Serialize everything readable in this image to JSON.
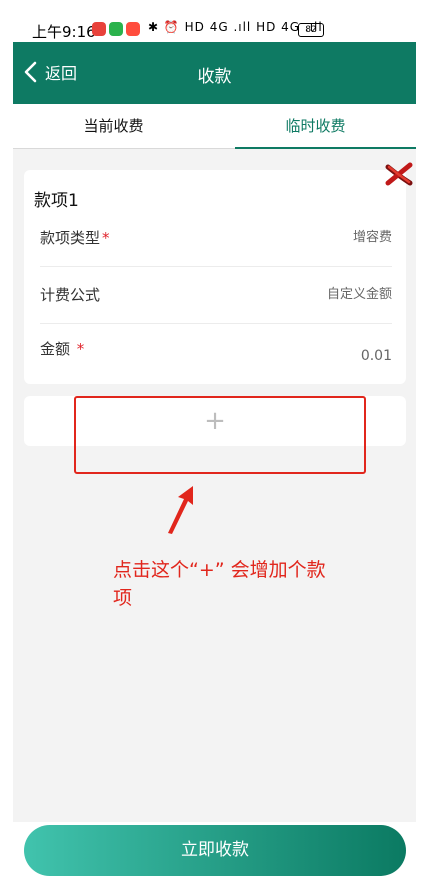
{
  "status_bar": {
    "time": "上午9:16",
    "indicators": "✱ ⏰ HD 4G .ıll HD 4G .ıll",
    "battery": "82"
  },
  "header": {
    "back_label": "返回",
    "title": "收款"
  },
  "tabs": [
    {
      "label": "当前收费",
      "active": false
    },
    {
      "label": "临时收费",
      "active": true
    }
  ],
  "item_card": {
    "title": "款项1",
    "rows": [
      {
        "label": "款项类型",
        "required": true,
        "value": "增容费"
      },
      {
        "label": "计费公式",
        "required": false,
        "value": "自定义金额"
      },
      {
        "label": "金额",
        "required": true,
        "value": "0.01"
      }
    ],
    "required_mark": "*"
  },
  "add_item": {
    "symbol": "+"
  },
  "annotation": {
    "line1": "点击这个“+” 会增加个款",
    "line2": "项"
  },
  "submit": {
    "label": "立即收款"
  },
  "colors": {
    "brand_green": "#0e7a63",
    "gradient_start": "#41c3ad",
    "annotation_red": "#e1261c",
    "required_red": "#e0242c"
  }
}
